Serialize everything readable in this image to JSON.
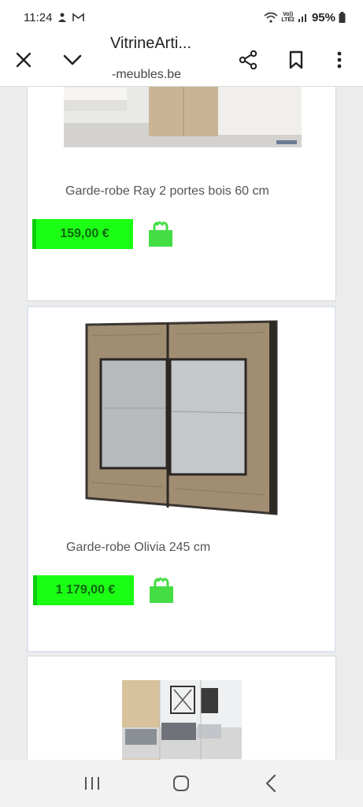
{
  "status": {
    "time": "11:24",
    "battery": "95%",
    "net_top": "Vo))",
    "net_bottom": "LTE2"
  },
  "toolbar": {
    "title": "VitrineArti...",
    "url": "-meubles.be"
  },
  "products": [
    {
      "name": "Garde-robe Ray 2 portes bois 60 cm",
      "price": "159,00 €"
    },
    {
      "name": "Garde-robe Olivia 245 cm",
      "price": "1 179,00 €"
    }
  ],
  "icons": {
    "close": "close-icon",
    "collapse": "chevron-down-icon",
    "share": "share-icon",
    "bookmark": "bookmark-icon",
    "menu": "more-vert-icon",
    "cart": "shopping-bag-icon"
  },
  "colors": {
    "price_bg": "#1bff14",
    "cart": "#44dd44"
  }
}
